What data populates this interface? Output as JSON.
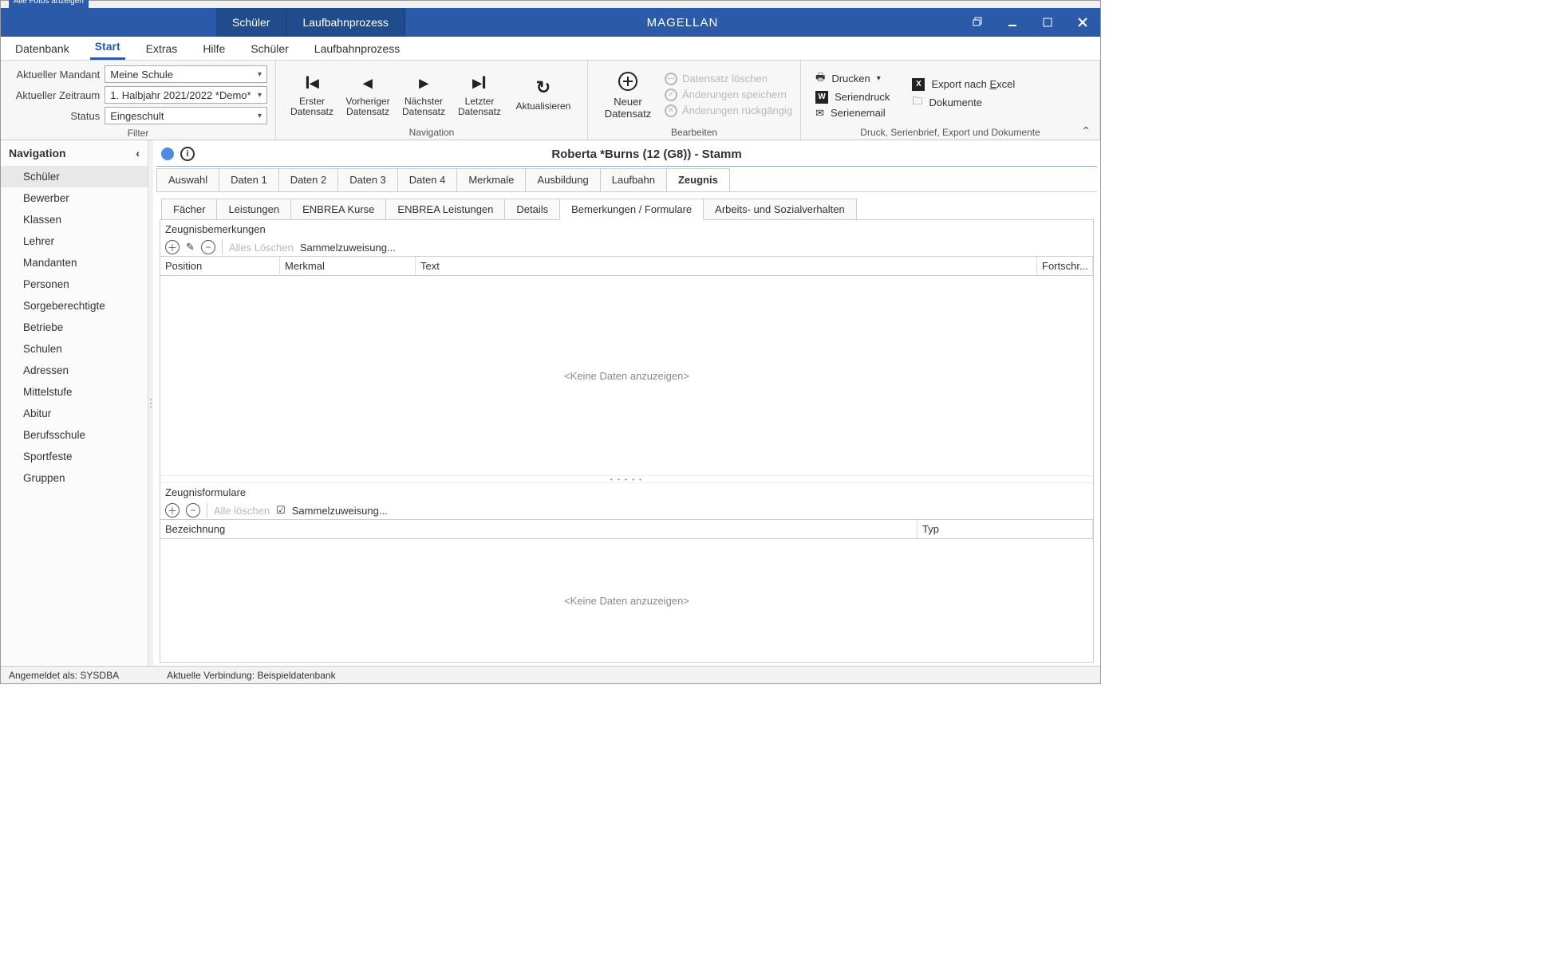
{
  "title_tabs": {
    "schueler": "Schüler",
    "laufbahn": "Laufbahnprozess"
  },
  "app_title": "MAGELLAN",
  "ribbon_tabs": [
    "Datenbank",
    "Start",
    "Extras",
    "Hilfe",
    "Schüler",
    "Laufbahnprozess"
  ],
  "ribbon_active": 1,
  "filter": {
    "mandant_label": "Aktueller Mandant",
    "mandant_value": "Meine Schule",
    "zeitraum_label": "Aktueller Zeitraum",
    "zeitraum_value": "1. Halbjahr 2021/2022 *Demo*",
    "status_label": "Status",
    "status_value": "Eingeschult",
    "group_label": "Filter"
  },
  "nav": {
    "first_l1": "Erster",
    "first_l2": "Datensatz",
    "prev_l1": "Vorheriger",
    "prev_l2": "Datensatz",
    "next_l1": "Nächster",
    "next_l2": "Datensatz",
    "last_l1": "Letzter",
    "last_l2": "Datensatz",
    "refresh": "Aktualisieren",
    "group_label": "Navigation"
  },
  "edit": {
    "new_l1": "Neuer",
    "new_l2": "Datensatz",
    "delete": "Datensatz löschen",
    "save": "Änderungen speichern",
    "undo": "Änderungen rückgängig",
    "group_label": "Bearbeiten"
  },
  "print": {
    "print": "Drucken",
    "seriendruck": "Seriendruck",
    "serienemail": "Serienemail",
    "export": "Export nach Excel",
    "dokumente": "Dokumente",
    "group_label": "Druck, Serienbrief, Export und Dokumente"
  },
  "sidebar": {
    "title": "Navigation",
    "items": [
      "Schüler",
      "Bewerber",
      "Klassen",
      "Lehrer",
      "Mandanten",
      "Personen",
      "Sorgeberechtigte",
      "Betriebe",
      "Schulen",
      "Adressen",
      "Mittelstufe",
      "Abitur",
      "Berufsschule",
      "Sportfeste",
      "Gruppen"
    ],
    "active": 0
  },
  "content": {
    "header": "Roberta *Burns (12 (G8)) - Stamm",
    "tabs": [
      "Auswahl",
      "Daten 1",
      "Daten 2",
      "Daten 3",
      "Daten 4",
      "Merkmale",
      "Ausbildung",
      "Laufbahn",
      "Zeugnis"
    ],
    "tab_active": 8,
    "subtabs": [
      "Fächer",
      "Leistungen",
      "ENBREA Kurse",
      "ENBREA Leistungen",
      "Details",
      "Bemerkungen / Formulare",
      "Arbeits- und Sozialverhalten"
    ],
    "subtab_active": 5
  },
  "bemerkungen": {
    "title": "Zeugnisbemerkungen",
    "alles_loeschen": "Alles Löschen",
    "sammel": "Sammelzuweisung...",
    "cols": {
      "position": "Position",
      "merkmal": "Merkmal",
      "text": "Text",
      "fortschr": "Fortschr..."
    },
    "empty": "<Keine Daten anzuzeigen>"
  },
  "formulare": {
    "title": "Zeugnisformulare",
    "alle_loeschen": "Alle löschen",
    "sammel": "Sammelzuweisung...",
    "cols": {
      "bezeichnung": "Bezeichnung",
      "typ": "Typ"
    },
    "empty": "<Keine Daten anzuzeigen>"
  },
  "status": {
    "login": "Angemeldet als: SYSDBA",
    "conn": "Aktuelle Verbindung: Beispieldatenbank"
  },
  "topstrip": "Alle Fotos anzeigen"
}
